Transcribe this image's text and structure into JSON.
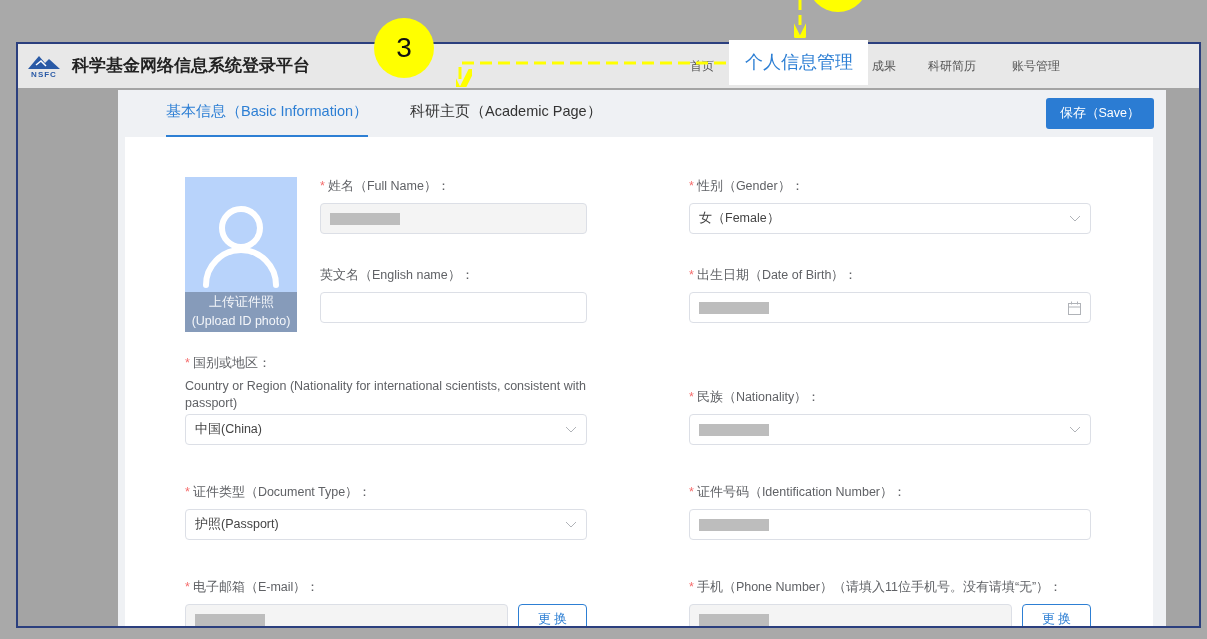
{
  "annotation": {
    "step_number": "3",
    "callout": "个人信息管理"
  },
  "header": {
    "logo_text": "NSFC",
    "title": "科学基金网络信息系统登录平台",
    "nav": [
      "首页",
      "成果",
      "科研简历",
      "账号管理"
    ]
  },
  "tabs": [
    {
      "label": "基本信息（Basic Information）",
      "selected": true
    },
    {
      "label": "科研主页（Academic Page）",
      "selected": false
    }
  ],
  "save_button": "保存（Save）",
  "required_mark": "*",
  "photo": {
    "caption": [
      "上传证件照",
      "(Upload ID photo)"
    ]
  },
  "rows": [
    {
      "left": {
        "label": "姓名（Full Name）：",
        "required": true,
        "kind": "text",
        "disabled": true,
        "redacted": true
      },
      "right": {
        "label": "性别（Gender）：",
        "required": true,
        "kind": "select",
        "value": "女（Female）"
      }
    },
    {
      "left": {
        "label": "英文名（English name）：",
        "required": false,
        "kind": "text"
      },
      "right": {
        "label": "出生日期（Date of Birth）：",
        "required": true,
        "kind": "date",
        "redacted": true
      }
    },
    {
      "left": {
        "label": "国别或地区：",
        "note": "Country or Region (Nationality for international scientists, consistent with passport)",
        "required": true,
        "kind": "select",
        "value": "中国(China)"
      },
      "right": {
        "label": "民族（Nationality）：",
        "required": true,
        "kind": "select",
        "redacted": true
      }
    },
    {
      "left": {
        "label": "证件类型（Document Type）：",
        "required": true,
        "kind": "select",
        "value": "护照(Passport)"
      },
      "right": {
        "label": "证件号码（Identification Number）：",
        "required": true,
        "kind": "text",
        "redacted": true
      }
    },
    {
      "left": {
        "label": "电子邮箱（E-mail）：",
        "required": true,
        "kind": "text",
        "disabled": true,
        "redacted": true,
        "button": "更 换"
      },
      "right": {
        "label": "手机（Phone Number）（请填入11位手机号。没有请填“无”）：",
        "required": true,
        "kind": "text",
        "disabled": true,
        "redacted": true,
        "button": "更 换"
      }
    }
  ]
}
